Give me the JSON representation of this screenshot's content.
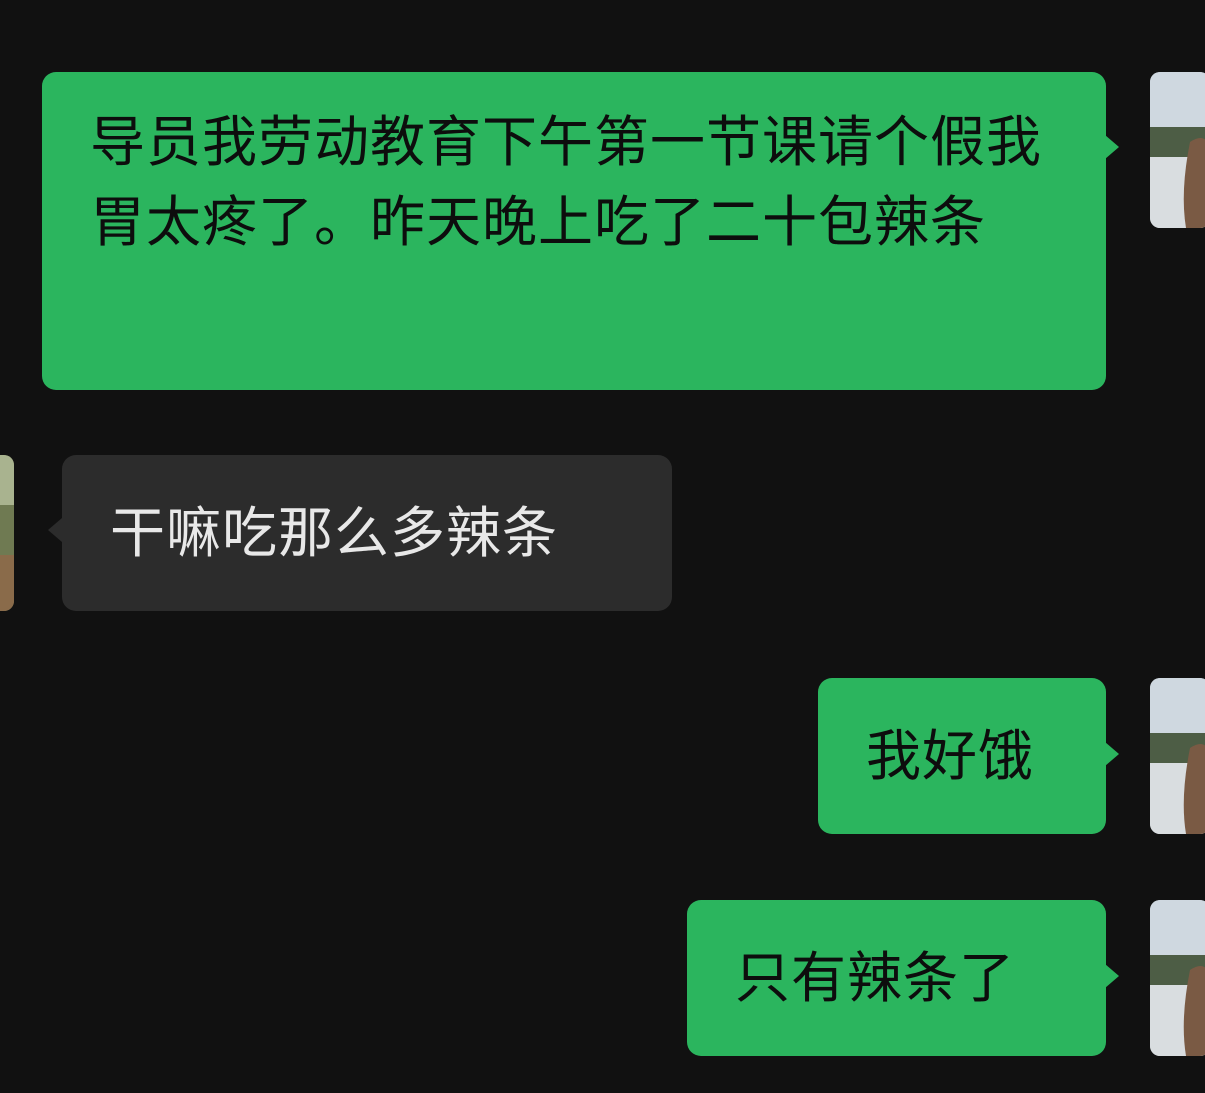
{
  "conversation": {
    "messages": [
      {
        "sender": "me",
        "text": "导员我劳动教育下午第一节课请个假我胃太疼了。昨天晚上吃了二十包辣条"
      },
      {
        "sender": "other",
        "text": "干嘛吃那么多辣条"
      },
      {
        "sender": "me",
        "text": "我好饿"
      },
      {
        "sender": "me",
        "text": "只有辣条了"
      }
    ]
  },
  "colors": {
    "background": "#111111",
    "my_bubble": "#2bb55e",
    "other_bubble": "#2c2c2c"
  },
  "icons": {
    "my_avatar": "user-avatar-icon",
    "other_avatar": "contact-avatar-icon"
  }
}
